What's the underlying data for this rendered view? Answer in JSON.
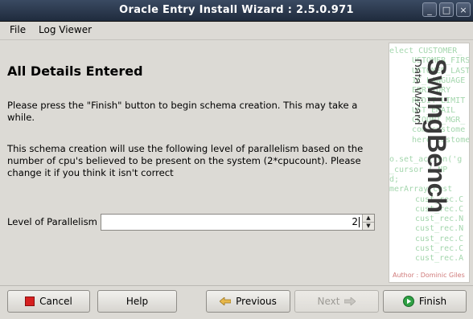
{
  "window": {
    "title": "Oracle Entry Install Wizard : 2.5.0.971",
    "controls": [
      "_",
      "□",
      "×"
    ]
  },
  "menu": [
    "File",
    "Log Viewer"
  ],
  "page": {
    "heading": "All Details Entered",
    "para1_line1": "Please press the \"Finish\" button to begin schema creation. This may take a",
    "para1_line2": "while.",
    "para2_line1": "This schema creation will use the following level of parallelism based on the",
    "para2_line2": "number of cpu's believed to be present on the system (2*cpucount). Please",
    "para2_line3": "change it if you think it isn't correct",
    "parallelism_label": "Level of Parallelism",
    "parallelism_value": "2"
  },
  "side_panel": {
    "logo_title": "SwingBench",
    "logo_subtitle": "Data Wizard",
    "author": "Author : Dominic Giles",
    "code_lines": [
      "elect CUSTOMER_",
      "USTOMER_FIRST",
      "USTOMER_LAST_",
      "IC_LANGUAGE",
      "ERRITORY",
      "REDIT_LIMIT",
      "UST_EMAIL",
      "CCOUNT_MGR_",
      "com custome",
      "here customer_",
      "",
      "o.set_action('g",
      "_cursor ( NP",
      "d;",
      "merArray(cust",
      "cust_rec.C",
      "cust_rec.C",
      "cust_rec.N",
      "cust_rec.N",
      "cust_rec.C",
      "cust_rec.C",
      "cust_rec.A"
    ],
    "colors": {
      "logo": "#3a3a3a",
      "code": "#59b56a",
      "author": "#d07a7a"
    }
  },
  "buttons": {
    "cancel": "Cancel",
    "help": "Help",
    "previous": "Previous",
    "next": "Next",
    "finish": "Finish"
  },
  "colors": {
    "titlebar": "#2a3850",
    "window_bg": "#dcdad5",
    "cancel_icon": "#d62020",
    "finish_icon": "#2ea043",
    "arrow_icon": "#e8b84a"
  }
}
